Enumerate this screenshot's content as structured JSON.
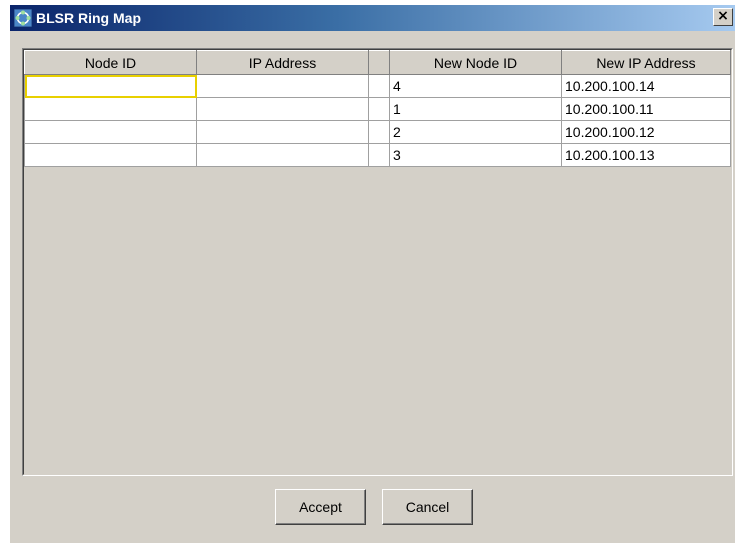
{
  "window": {
    "title": "BLSR Ring Map",
    "close_glyph": "×"
  },
  "table": {
    "headers": [
      "Node ID",
      "IP Address",
      "",
      "New Node ID",
      "New IP Address"
    ],
    "rows": [
      {
        "node_id": "",
        "ip_address": "",
        "new_node_id": "4",
        "new_ip_address": "10.200.100.14"
      },
      {
        "node_id": "",
        "ip_address": "",
        "new_node_id": "1",
        "new_ip_address": "10.200.100.11"
      },
      {
        "node_id": "",
        "ip_address": "",
        "new_node_id": "2",
        "new_ip_address": "10.200.100.12"
      },
      {
        "node_id": "",
        "ip_address": "",
        "new_node_id": "3",
        "new_ip_address": "10.200.100.13"
      }
    ]
  },
  "buttons": {
    "accept_label": "Accept",
    "cancel_label": "Cancel"
  },
  "colors": {
    "title_start": "#0a246a",
    "title_end": "#a6caf0",
    "focus_outline": "#e8d000",
    "face": "#d4d0c8"
  }
}
